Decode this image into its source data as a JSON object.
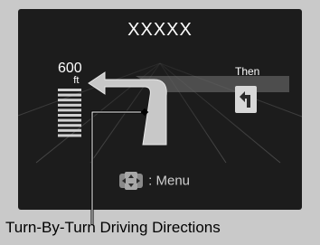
{
  "nav": {
    "street_name": "XXXXX",
    "distance_value": "600",
    "distance_unit": "ft",
    "then_label": "Then",
    "menu_label": ": Menu",
    "distance_bars": {
      "total": 10,
      "filled": 10
    }
  },
  "caption": "Turn-By-Turn Driving Directions",
  "icons": {
    "next_turn": "turn-left-icon",
    "menu": "dial-icon"
  },
  "colors": {
    "screen_bg": "#1c1c1c",
    "frame_bg": "#c9c9c9",
    "route": "#c8c8c8"
  }
}
